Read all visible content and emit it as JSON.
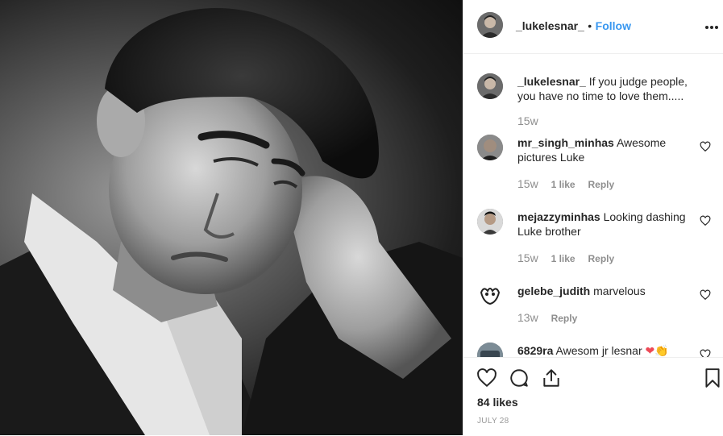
{
  "post": {
    "author": "_lukelesnar_",
    "follow_separator": "•",
    "follow_label": "Follow",
    "more_label": "•••",
    "likes": "84 likes",
    "date": "JULY 28"
  },
  "caption": {
    "author": "_lukelesnar_",
    "text": "If you judge people, you have no time to love them.....",
    "time": "15w"
  },
  "comments": [
    {
      "author": "mr_singh_minhas",
      "text": "Awesome pictures Luke",
      "time": "15w",
      "likes": "1 like",
      "reply": "Reply"
    },
    {
      "author": "mejazzyminhas",
      "text": "Looking dashing Luke brother",
      "time": "15w",
      "likes": "1 like",
      "reply": "Reply"
    },
    {
      "author": "gelebe_judith",
      "text": "marvelous",
      "time": "13w",
      "reply": "Reply"
    },
    {
      "author": "6829ra",
      "text": "Awesom jr lesnar",
      "emoji": "❤👏"
    }
  ],
  "icons": {
    "like": "heart-icon",
    "comment": "comment-icon",
    "share": "share-icon",
    "save": "bookmark-icon"
  },
  "colors": {
    "accent": "#3897f0",
    "text": "#262626",
    "muted": "#8e8e8e",
    "heart": "#ed4956"
  }
}
